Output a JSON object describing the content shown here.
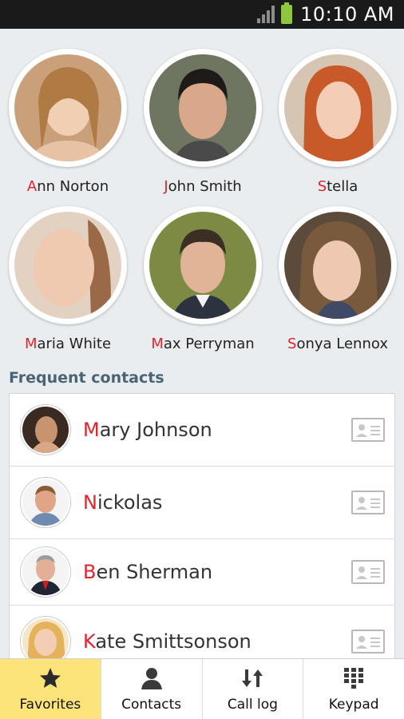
{
  "status_bar": {
    "time": "10:10 AM",
    "battery_color": "#8dc63f"
  },
  "favorites": [
    {
      "initial": "A",
      "rest": "nn Norton",
      "photo": "photo-ann-norton"
    },
    {
      "initial": "J",
      "rest": "ohn Smith",
      "photo": "photo-john-smith"
    },
    {
      "initial": "S",
      "rest": "tella",
      "photo": "photo-stella"
    },
    {
      "initial": "M",
      "rest": "aria White",
      "photo": "photo-maria-white"
    },
    {
      "initial": "M",
      "rest": "ax Perryman",
      "photo": "photo-max-perryman"
    },
    {
      "initial": "S",
      "rest": "onya Lennox",
      "photo": "photo-sonya-lennox"
    }
  ],
  "frequent": {
    "header": "Frequent contacts",
    "items": [
      {
        "initial": "M",
        "rest": "ary Johnson"
      },
      {
        "initial": "N",
        "rest": "ickolas"
      },
      {
        "initial": "B",
        "rest": "en Sherman"
      },
      {
        "initial": "K",
        "rest": "ate Smittsonson"
      }
    ]
  },
  "tabs": [
    {
      "label": "Favorites",
      "icon": "star-icon",
      "active": true
    },
    {
      "label": "Contacts",
      "icon": "person-icon",
      "active": false
    },
    {
      "label": "Call log",
      "icon": "call-log-arrows-icon",
      "active": false
    },
    {
      "label": "Keypad",
      "icon": "keypad-grid-icon",
      "active": false
    }
  ],
  "colors": {
    "accent_initial": "#e0232d",
    "active_tab": "#fde47a",
    "header_text": "#4a6476"
  }
}
